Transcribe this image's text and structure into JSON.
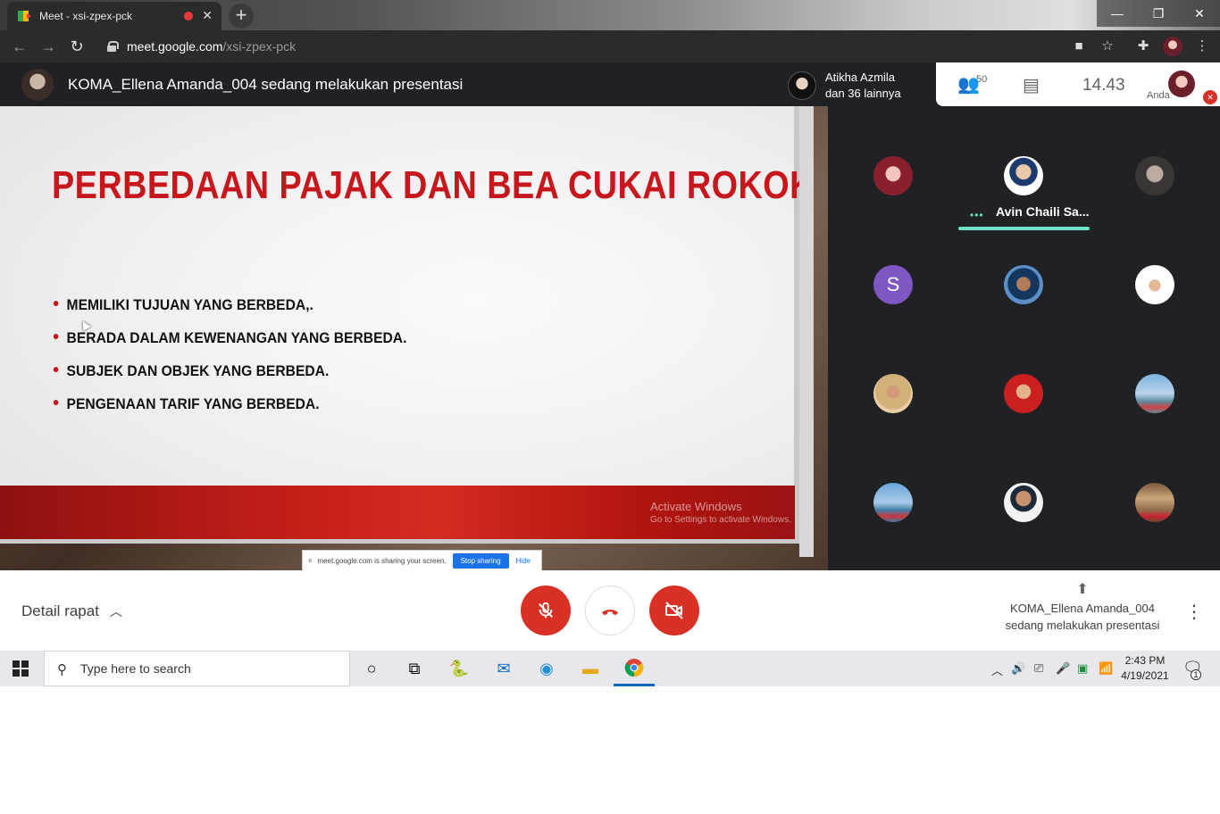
{
  "browser": {
    "tab_title": "Meet - xsi-zpex-pck",
    "url_host": "meet.google.com",
    "url_path": "/xsi-zpex-pck"
  },
  "meet": {
    "presenter_banner": "KOMA_Ellena Amanda_004 sedang melakukan presentasi",
    "joined_name": "Atikha Azmila",
    "joined_others": "dan 36 lainnya",
    "participant_count": "50",
    "time": "14.43",
    "self_label": "Anda",
    "active_speaker": "Avin Chaili Sa...",
    "tile_letter": "S",
    "detail_label": "Detail rapat",
    "presenting_line1": "KOMA_Ellena Amanda_004",
    "presenting_line2": "sedang melakukan presentasi"
  },
  "slide": {
    "title": "PERBEDAAN PAJAK DAN BEA CUKAI ROKOK",
    "bullets": [
      "MEMILIKI TUJUAN YANG BERBEDA,.",
      "BERADA DALAM KEWENANGAN YANG BERBEDA.",
      "SUBJEK DAN OBJEK YANG BERBEDA.",
      "PENGENAAN TARIF YANG BERBEDA."
    ],
    "watermark_line1": "Activate Windows",
    "watermark_line2": "Go to Settings to activate Windows."
  },
  "sharebar": {
    "text": "meet.google.com is sharing your screen.",
    "stop_label": "Stop sharing",
    "hide_label": "Hide"
  },
  "taskbar": {
    "search_placeholder": "Type here to search",
    "time": "2:43 PM",
    "date": "4/19/2021",
    "notification_count": "1"
  },
  "colors": {
    "meet_dark": "#202124",
    "meet_red": "#d93025",
    "slide_red": "#c8161d",
    "speaker_accent": "#6fe3c8",
    "tile_purple": "#7e57c2"
  }
}
